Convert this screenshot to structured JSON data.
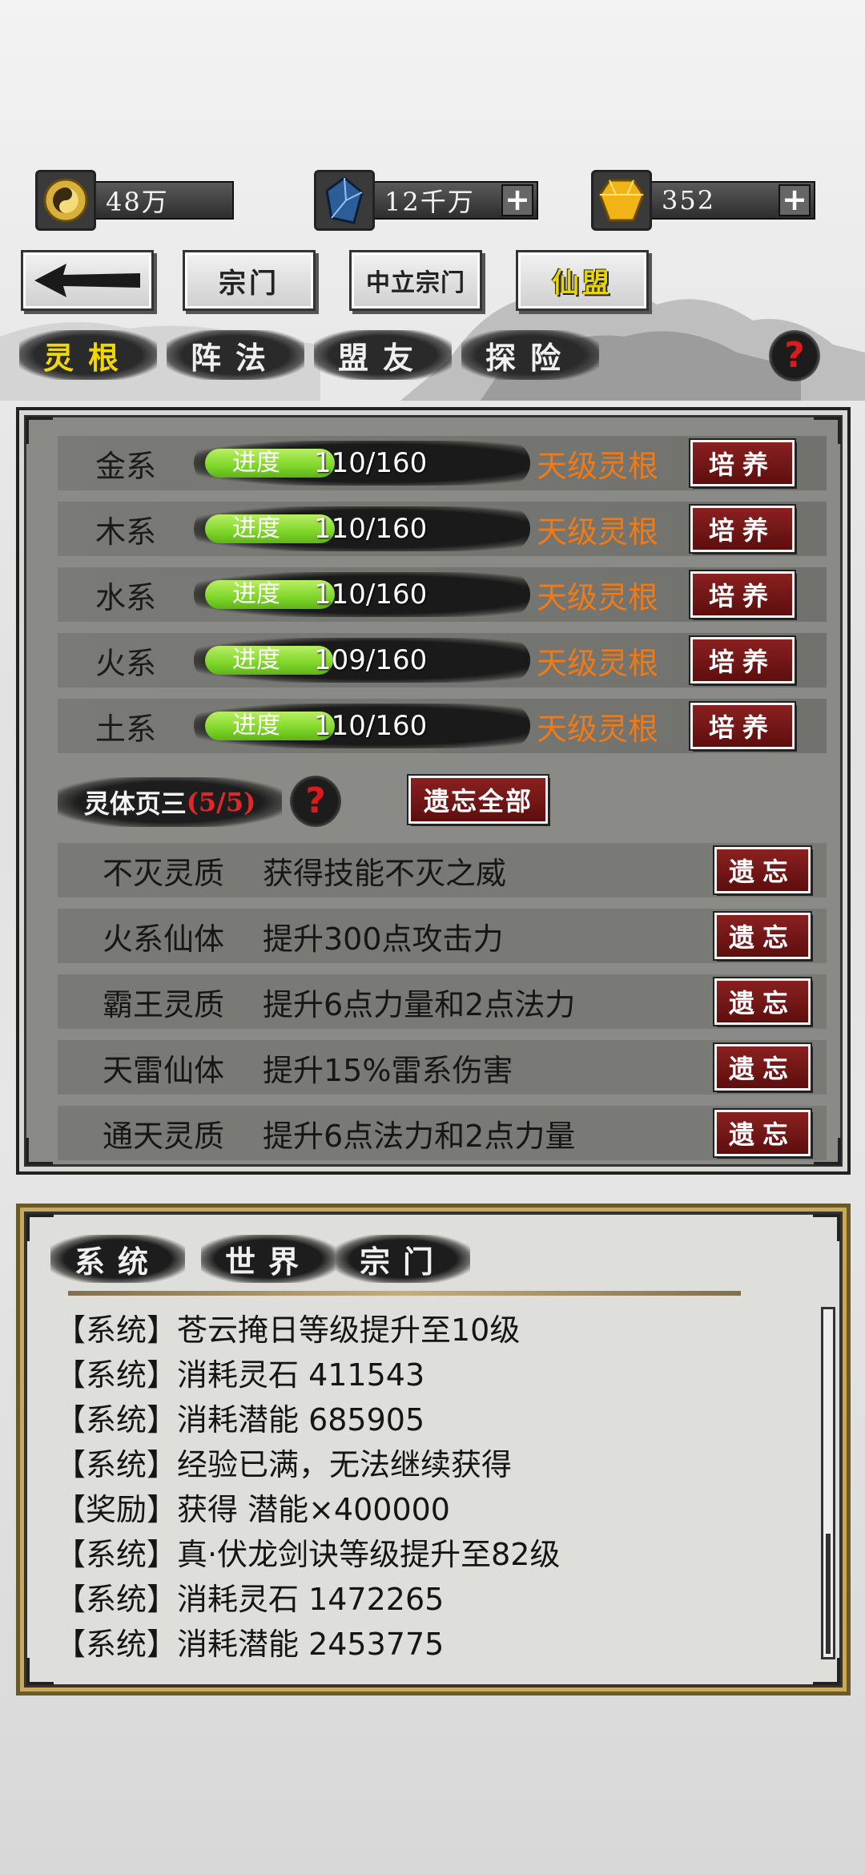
{
  "currencies": [
    {
      "icon": "gold-coin-icon",
      "value": "48万",
      "has_plus": false
    },
    {
      "icon": "blue-crystal-icon",
      "value": "12千万",
      "has_plus": true
    },
    {
      "icon": "gold-gem-icon",
      "value": "352",
      "has_plus": true
    }
  ],
  "nav": {
    "back_icon": "back-arrow-icon",
    "buttons": [
      "宗门",
      "中立宗门",
      "仙盟"
    ],
    "active_button": "仙盟"
  },
  "sub_tabs": [
    "灵根",
    "阵法",
    "盟友",
    "探险"
  ],
  "active_sub_tab": "灵根",
  "spirit_roots": [
    {
      "name": "金系",
      "progress_label": "进度",
      "progress": "110/160",
      "grade": "天级灵根",
      "action": "培养"
    },
    {
      "name": "木系",
      "progress_label": "进度",
      "progress": "110/160",
      "grade": "天级灵根",
      "action": "培养"
    },
    {
      "name": "水系",
      "progress_label": "进度",
      "progress": "110/160",
      "grade": "天级灵根",
      "action": "培养"
    },
    {
      "name": "火系",
      "progress_label": "进度",
      "progress": "109/160",
      "grade": "天级灵根",
      "action": "培养"
    },
    {
      "name": "土系",
      "progress_label": "进度",
      "progress": "110/160",
      "grade": "天级灵根",
      "action": "培养"
    }
  ],
  "body_section": {
    "title": "灵体页三",
    "count": "(5/5)",
    "forget_all": "遗忘全部",
    "items": [
      {
        "name": "不灭灵质",
        "desc": "获得技能不灭之威",
        "action": "遗忘"
      },
      {
        "name": "火系仙体",
        "desc": "提升300点攻击力",
        "action": "遗忘"
      },
      {
        "name": "霸王灵质",
        "desc": "提升6点力量和2点法力",
        "action": "遗忘"
      },
      {
        "name": "天雷仙体",
        "desc": "提升15%雷系伤害",
        "action": "遗忘"
      },
      {
        "name": "通天灵质",
        "desc": "提升6点法力和2点力量",
        "action": "遗忘"
      }
    ]
  },
  "chat": {
    "tabs": [
      "系统",
      "世界",
      "宗门"
    ],
    "messages": [
      "【系统】苍云掩日等级提升至10级",
      "【系统】消耗灵石 411543",
      "【系统】消耗潜能 685905",
      "【系统】经验已满，无法继续获得",
      "【奖励】获得 潜能×400000",
      "【系统】真·伏龙剑诀等级提升至82级",
      "【系统】消耗灵石 1472265",
      "【系统】消耗潜能 2453775"
    ]
  },
  "help_icon": "question-mark-icon",
  "colors": {
    "grade": "#f07a15",
    "progress": "#7fd62a",
    "accent_red": "#6e1414",
    "active_yellow": "#f2d800"
  }
}
